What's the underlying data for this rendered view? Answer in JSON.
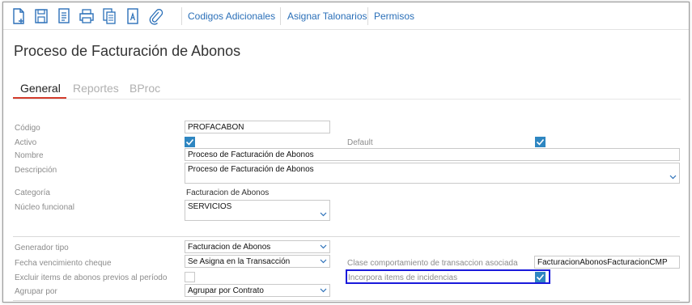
{
  "toolbar": {
    "icons": [
      "new-document-icon",
      "save-icon",
      "document-list-icon",
      "print-icon",
      "copy-icon",
      "text-document-icon",
      "attachment-icon"
    ],
    "links": {
      "codigos": "Codigos Adicionales",
      "asignar": "Asignar Talonarios",
      "permisos": "Permisos"
    }
  },
  "page": {
    "title": "Proceso de Facturación de Abonos"
  },
  "tabs": [
    {
      "label": "General",
      "active": true
    },
    {
      "label": "Reportes",
      "active": false
    },
    {
      "label": "BProc",
      "active": false
    }
  ],
  "form": {
    "codigo": {
      "label": "Código",
      "value": "PROFACABON"
    },
    "activo": {
      "label": "Activo",
      "checked": true
    },
    "default": {
      "label": "Default",
      "checked": true
    },
    "nombre": {
      "label": "Nombre",
      "value": "Proceso de Facturación de Abonos"
    },
    "descripcion": {
      "label": "Descripción",
      "value": "Proceso de Facturación de Abonos"
    },
    "categoria": {
      "label": "Categoría",
      "value": "Facturacion de Abonos"
    },
    "nucleo": {
      "label": "Núcleo funcional",
      "value": "SERVICIOS"
    },
    "generador": {
      "label": "Generador tipo",
      "value": "Facturacion de Abonos"
    },
    "fecha_venc": {
      "label": "Fecha vencimiento cheque",
      "value": "Se Asigna en la Transacción"
    },
    "clase_comp": {
      "label": "Clase comportamiento de transaccion asociada",
      "value": "FacturacionAbonosFacturacionCMP"
    },
    "excluir": {
      "label": "Excluir items de abonos previos al período",
      "checked": false
    },
    "incorpora": {
      "label": "Incorpora items de incidencias",
      "checked": true
    },
    "agrupar": {
      "label": "Agrupar por",
      "value": "Agrupar por Contrato"
    }
  },
  "colors": {
    "link": "#2a6fb8",
    "tab_accent": "#d33b2c",
    "checkbox": "#2e86c1",
    "highlight": "#1a1adb"
  }
}
